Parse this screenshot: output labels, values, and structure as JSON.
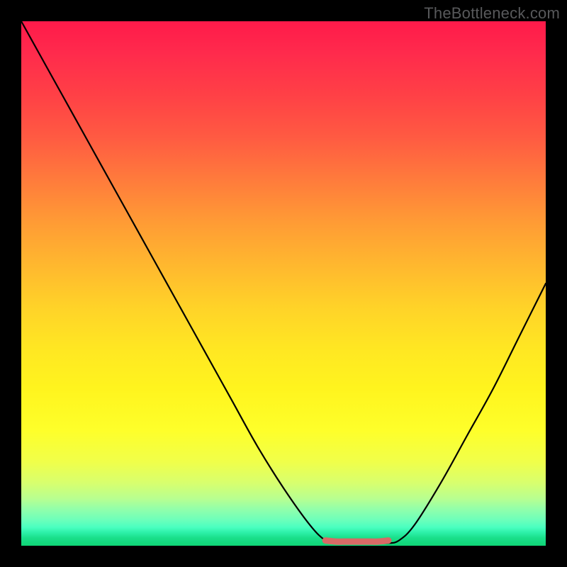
{
  "watermark": "TheBottleneck.com",
  "chart_data": {
    "type": "line",
    "title": "",
    "xlabel": "",
    "ylabel": "",
    "xlim": [
      0,
      100
    ],
    "ylim": [
      0,
      100
    ],
    "series": [
      {
        "name": "curve",
        "x": [
          0,
          5,
          10,
          15,
          20,
          25,
          30,
          35,
          40,
          45,
          50,
          55,
          58,
          60,
          62,
          65,
          68,
          70,
          72,
          75,
          80,
          85,
          90,
          95,
          100
        ],
        "values": [
          100,
          91,
          82,
          73,
          64,
          55,
          46,
          37,
          28,
          19,
          11,
          4,
          1,
          0.5,
          0.5,
          0.5,
          0.5,
          0.5,
          1,
          4,
          12,
          21,
          30,
          40,
          50
        ]
      },
      {
        "name": "marker-segment",
        "x": [
          58,
          60,
          62,
          64,
          66,
          68,
          70
        ],
        "values": [
          1,
          0.8,
          0.8,
          0.8,
          0.8,
          0.8,
          1
        ]
      }
    ],
    "gradient_stops": [
      {
        "pos": 0,
        "color": "#ff1a4a"
      },
      {
        "pos": 0.5,
        "color": "#ffd428"
      },
      {
        "pos": 0.78,
        "color": "#feff2a"
      },
      {
        "pos": 1.0,
        "color": "#0fd576"
      }
    ],
    "marker_color": "#d86a66"
  }
}
